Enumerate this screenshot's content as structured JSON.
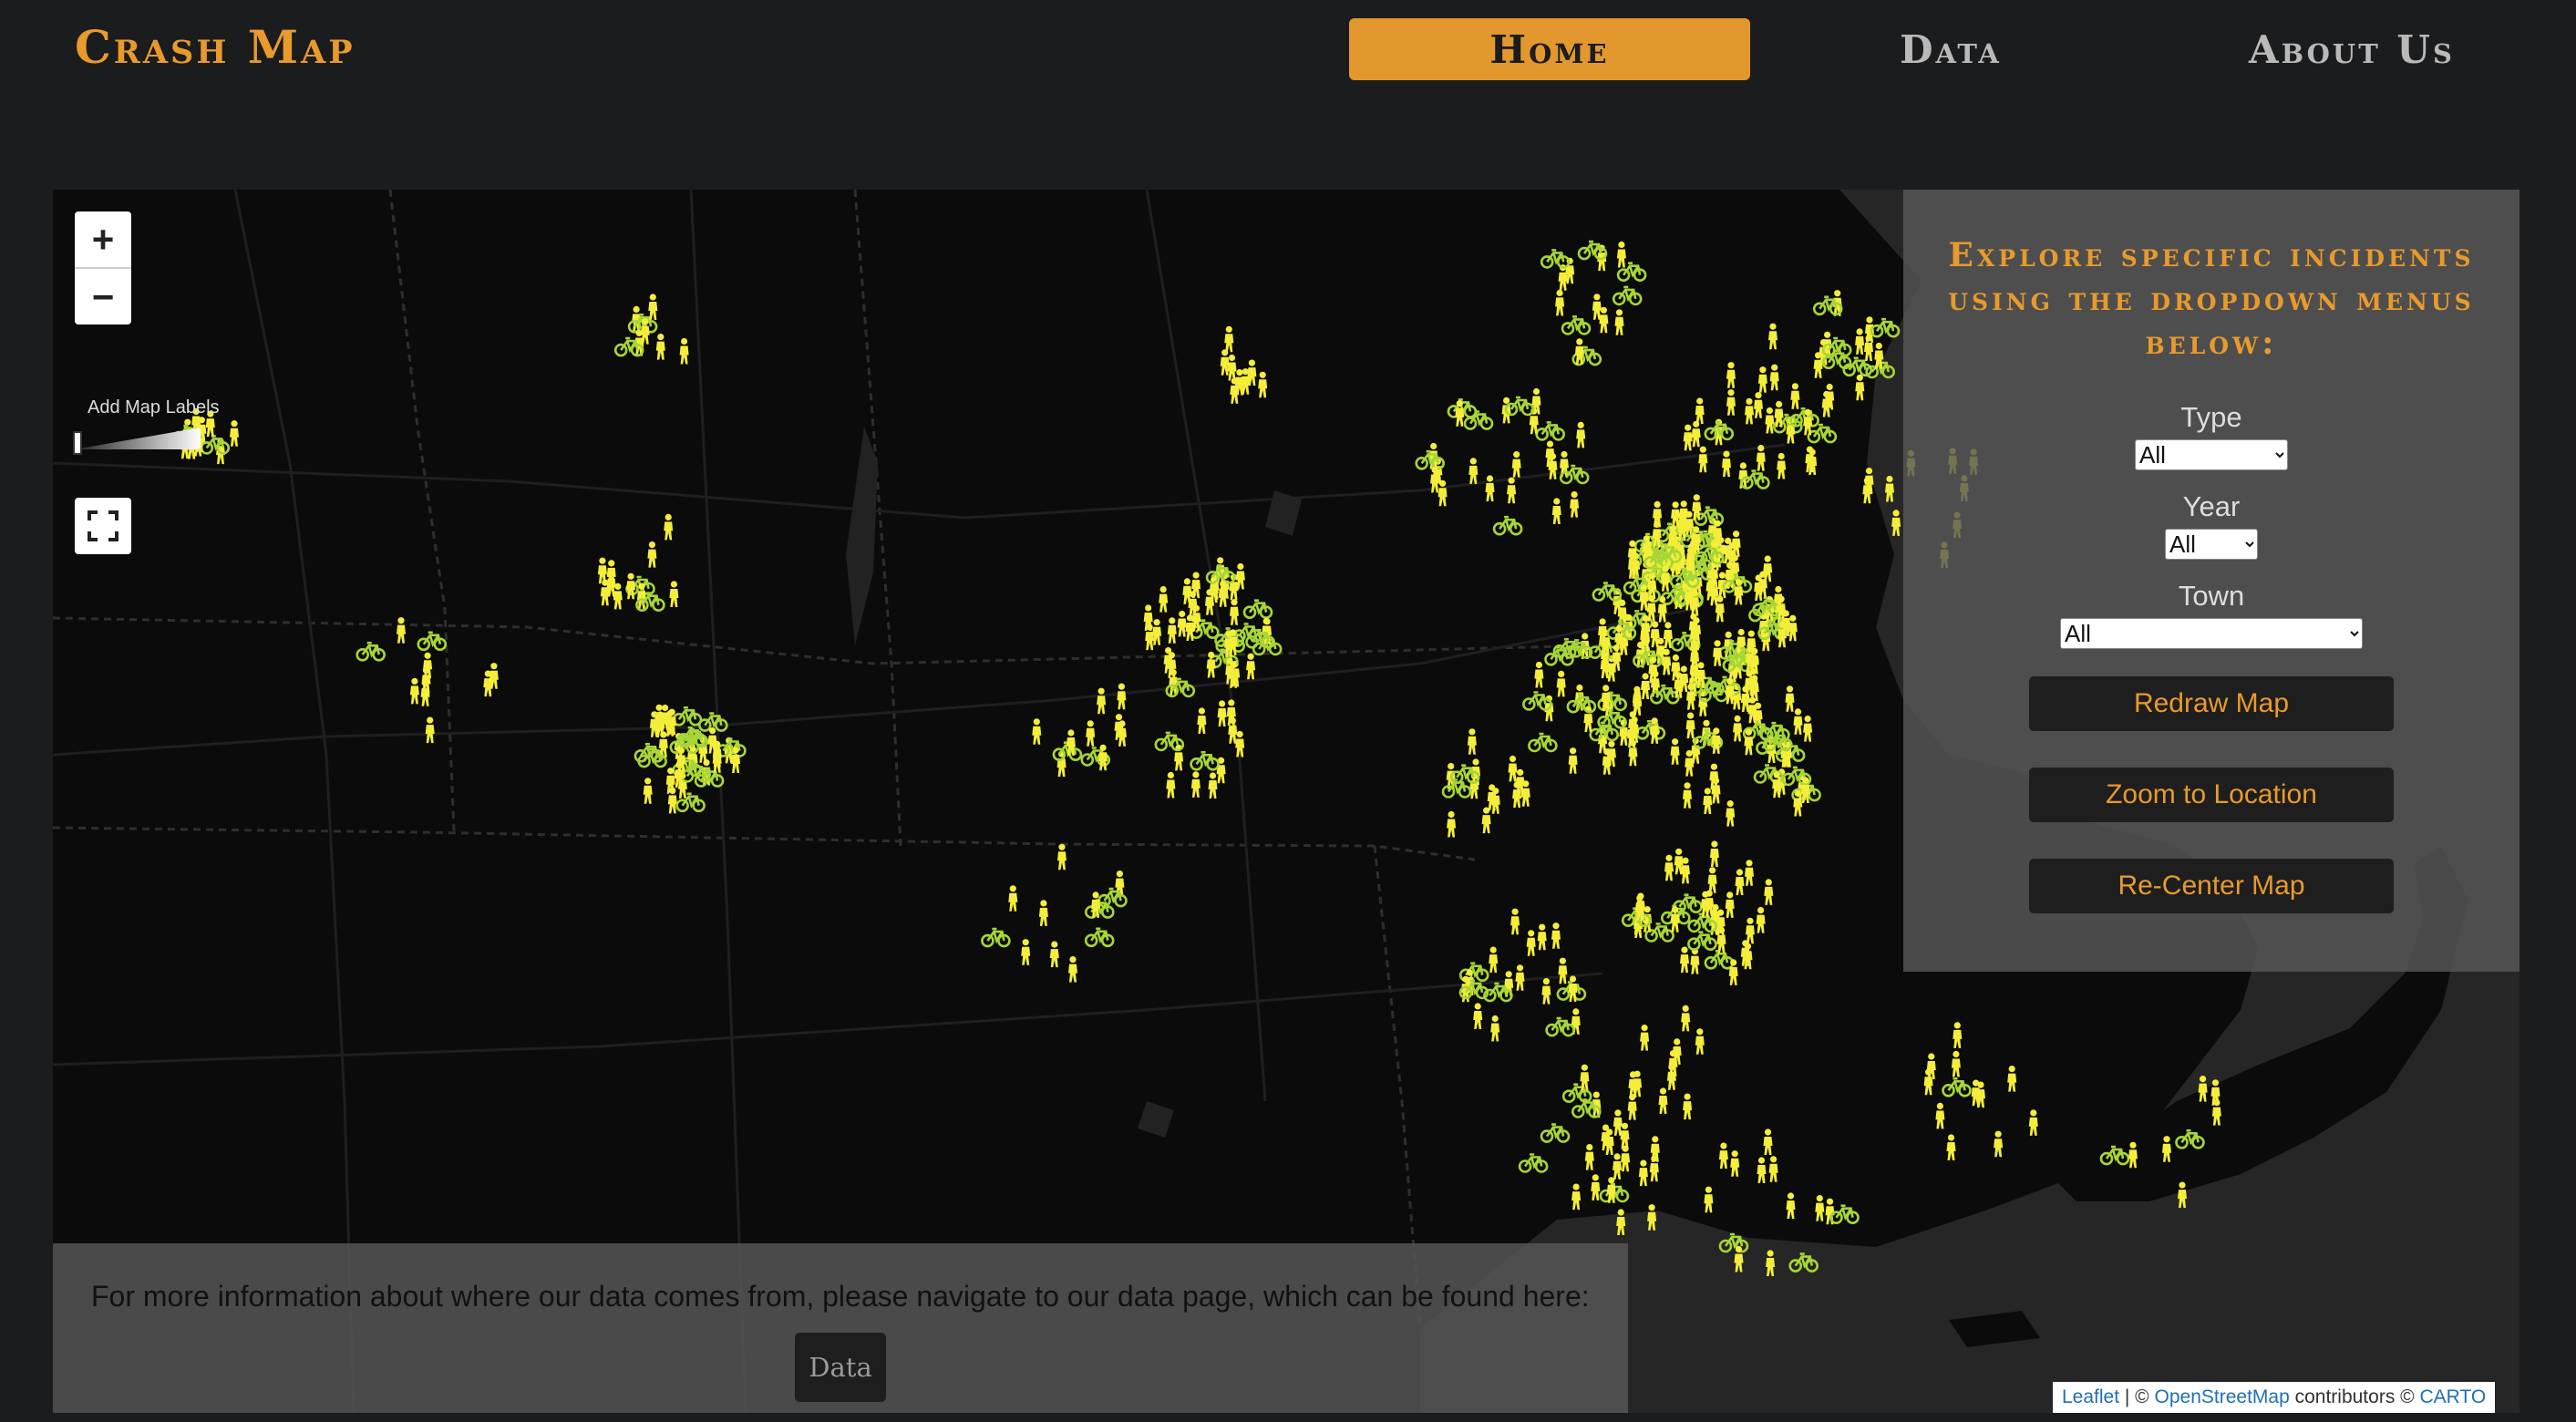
{
  "navbar": {
    "brand": "Crash Map",
    "links": [
      {
        "label": "Home",
        "active": true
      },
      {
        "label": "Data",
        "active": false
      },
      {
        "label": "About Us",
        "active": false
      }
    ]
  },
  "map": {
    "controls": {
      "zoom_in": "+",
      "zoom_out": "−",
      "labels_title": "Add Map Labels"
    },
    "icons": {
      "pedestrian": "pedestrian-icon",
      "bicycle": "bicycle-icon",
      "fullscreen": "fullscreen-icon"
    },
    "colors": {
      "pedestrian": "#f4ee3a",
      "bicycle": "#a7d636",
      "land": "#0b0b0b",
      "water": "#2a2a2a",
      "accent": "#e89a2c"
    },
    "attribution": {
      "leaflet": "Leaflet",
      "sep": " | © ",
      "osm": "OpenStreetMap",
      "mid": " contributors © ",
      "carto": "CARTO"
    }
  },
  "panel": {
    "title": "Explore specific incidents using the dropdown menus below:",
    "type_label": "Type",
    "type_value": "All",
    "year_label": "Year",
    "year_value": "All",
    "town_label": "Town",
    "town_value": "All",
    "redraw_label": "Redraw Map",
    "zoom_label": "Zoom to Location",
    "recenter_label": "Re-Center Map"
  },
  "footer_box": {
    "text": "For more information about where our data comes from, please navigate to our data page, which can be found here:",
    "button_label": "Data"
  }
}
